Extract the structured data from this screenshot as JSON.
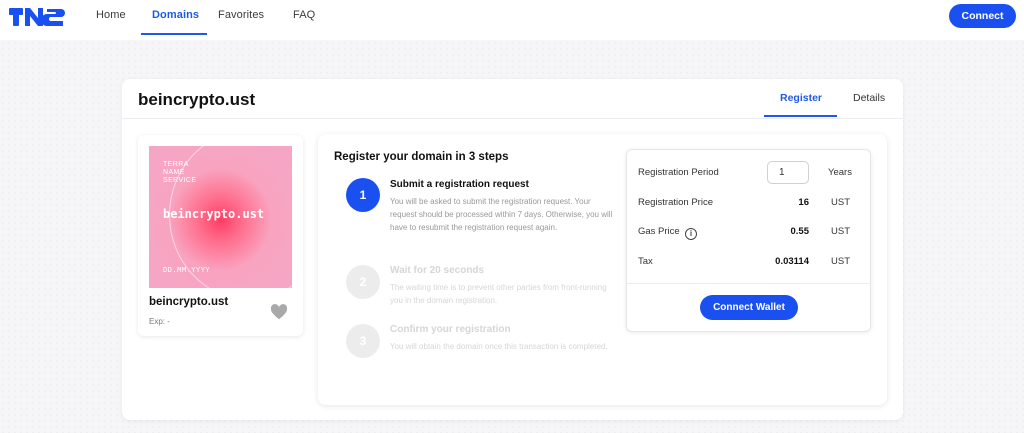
{
  "nav": {
    "items": [
      {
        "label": "Home",
        "active": false
      },
      {
        "label": "Domains",
        "active": true
      },
      {
        "label": "Favorites",
        "active": false
      },
      {
        "label": "FAQ",
        "active": false
      }
    ],
    "connect_label": "Connect"
  },
  "domain": {
    "title": "beincrypto.ust",
    "tabs": [
      {
        "label": "Register",
        "active": true
      },
      {
        "label": "Details",
        "active": false
      }
    ]
  },
  "nft": {
    "service_text": "TERRA\nNAME\nSERVICE",
    "name": "beincrypto.ust",
    "date": "DD.MM.YYYY",
    "label": "beincrypto.ust",
    "exp": "Exp: -",
    "icon": "heart-icon"
  },
  "steps": {
    "title": "Register your domain in 3 steps",
    "items": [
      {
        "number": "1",
        "title": "Submit a registration request",
        "desc": "You will be asked to submit the registration request. Your request should be processed within 7 days. Otherwise, you will have to resubmit the registration request again.",
        "active": true
      },
      {
        "number": "2",
        "title": "Wait for 20 seconds",
        "desc": "The waiting time is to prevent other parties from front-running you in the domain registration.",
        "active": false
      },
      {
        "number": "3",
        "title": "Confirm your registration",
        "desc": "You will obtain the domain once this transaction is completed.",
        "active": false
      }
    ]
  },
  "form": {
    "period_label": "Registration Period",
    "period_value": "1",
    "period_unit": "Years",
    "price_label": "Registration Price",
    "price_value": "16",
    "price_unit": "UST",
    "gas_label": "Gas Price",
    "gas_value": "0.55",
    "gas_unit": "UST",
    "tax_label": "Tax",
    "tax_value": "0.03114",
    "tax_unit": "UST",
    "wallet_label": "Connect Wallet"
  },
  "colors": {
    "accent": "#1a50ef"
  }
}
